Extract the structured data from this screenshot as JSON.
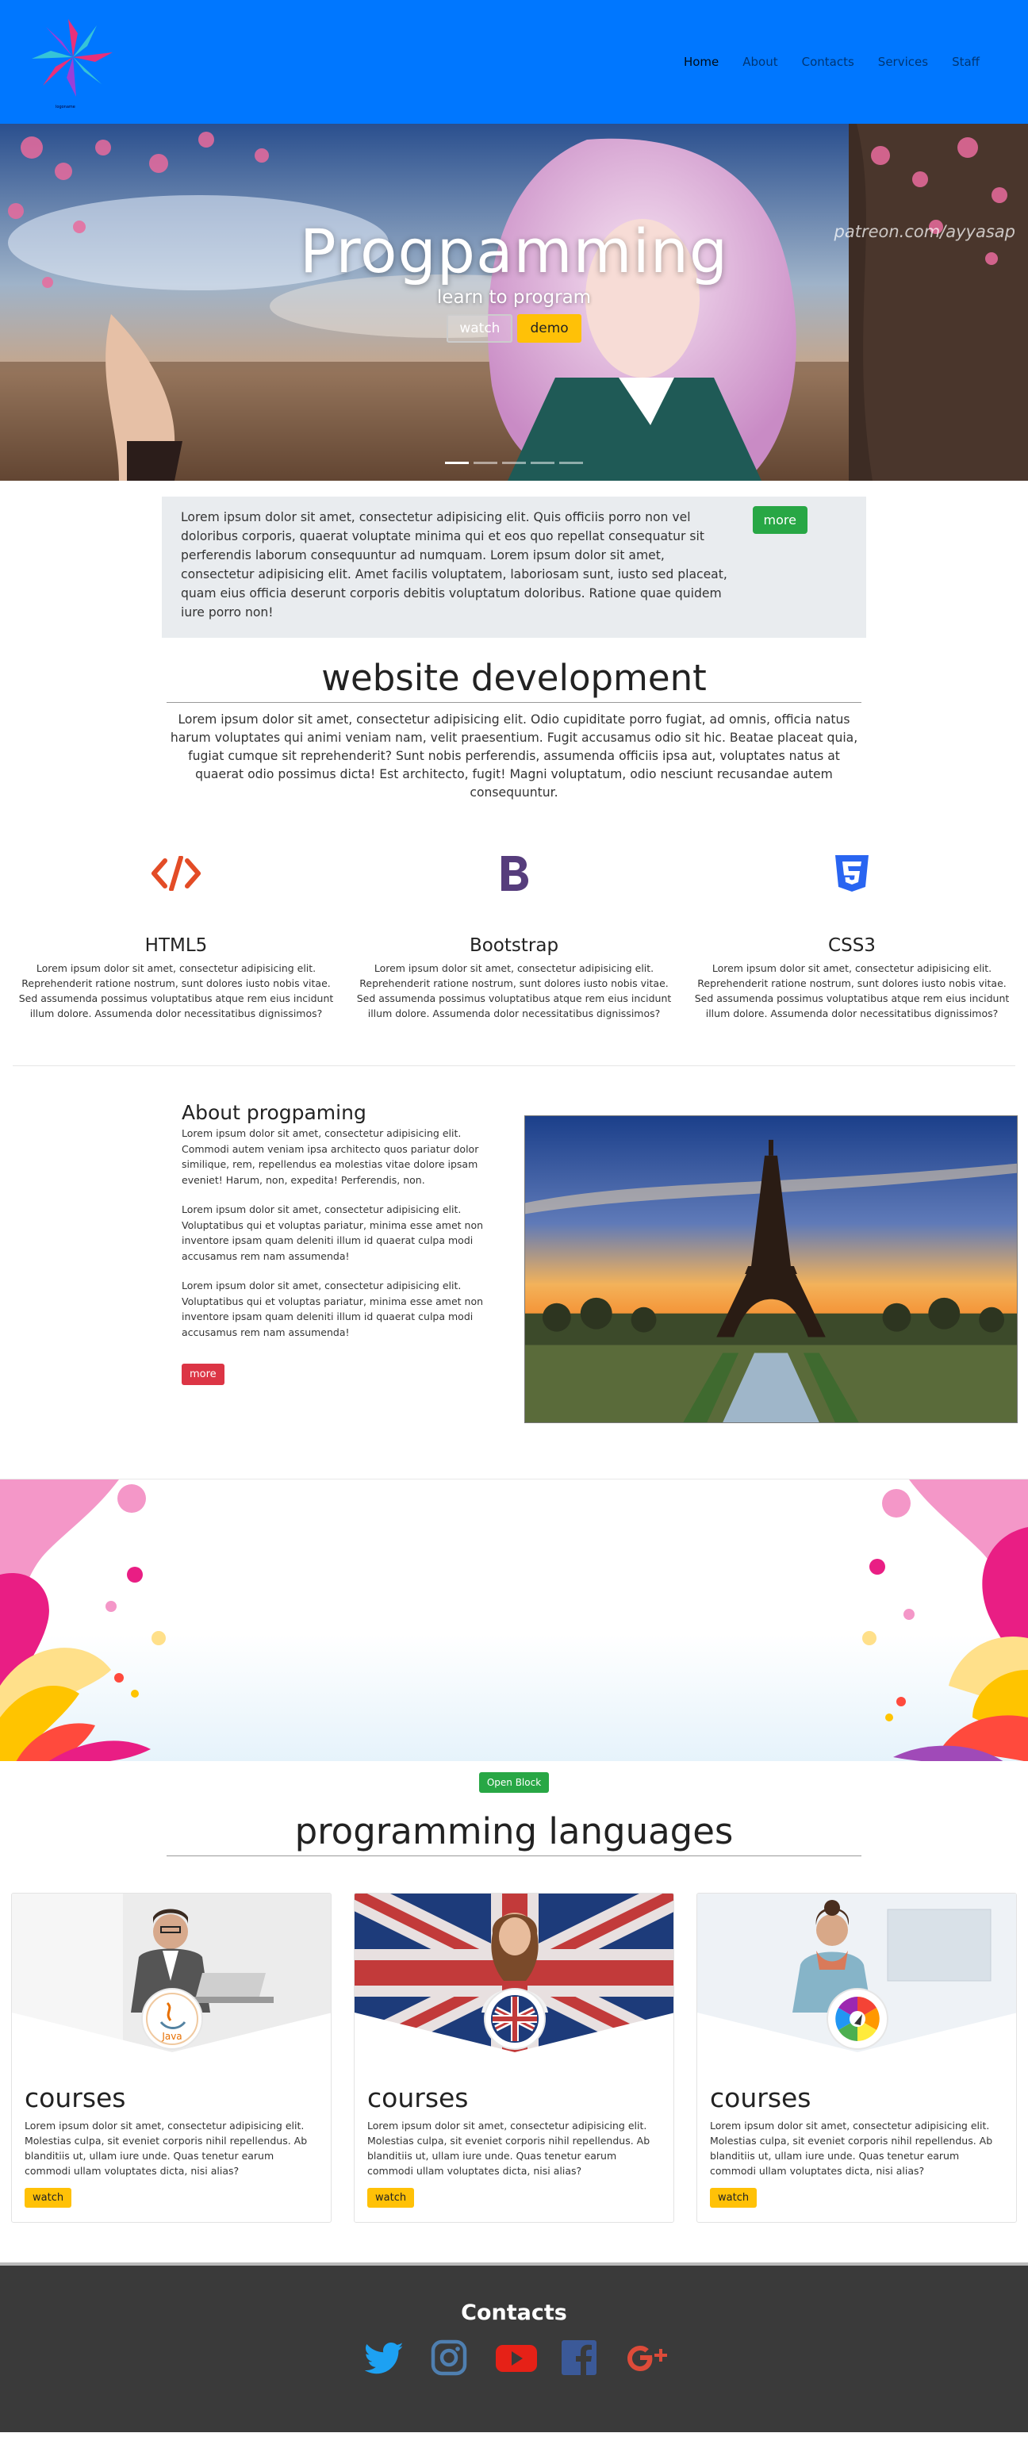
{
  "nav": {
    "logo_caption": "logoname",
    "items": [
      {
        "label": "Home",
        "active": true
      },
      {
        "label": "About",
        "active": false
      },
      {
        "label": "Contacts",
        "active": false
      },
      {
        "label": "Services",
        "active": false
      },
      {
        "label": "Staff",
        "active": false
      }
    ]
  },
  "hero": {
    "title": "Progpamming",
    "subtitle": "learn to program",
    "watch_label": "watch",
    "demo_label": "demo",
    "watermark": "patreon.com/ayyasap",
    "slides": 5,
    "active_slide": 0
  },
  "info": {
    "text": "Lorem ipsum dolor sit amet, consectetur adipisicing elit. Quis officiis porro non vel doloribus corporis, quaerat voluptate minima qui et eos quo repellat consequatur sit perferendis laborum consequuntur ad numquam. Lorem ipsum dolor sit amet, consectetur adipisicing elit. Amet facilis voluptatem, laboriosam sunt, iusto sed placeat, quam eius officia deserunt corporis debitis voluptatum doloribus. Ratione quae quidem iure porro non!",
    "more_label": "more"
  },
  "webdev": {
    "title": "website development",
    "text": "Lorem ipsum dolor sit amet, consectetur adipisicing elit. Odio cupiditate porro fugiat, ad omnis, officia natus harum voluptates qui animi veniam nam, velit praesentium. Fugit accusamus odio sit hic. Beatae placeat quia, fugiat cumque sit reprehenderit? Sunt nobis perferendis, assumenda officiis ipsa aut, voluptates natus at quaerat odio possimus dicta! Est architecto, fugit! Magni voluptatum, odio nesciunt recusandae autem consequuntur."
  },
  "features": [
    {
      "title": "HTML5",
      "icon": "code-icon",
      "color": "#e34c26",
      "text": "Lorem ipsum dolor sit amet, consectetur adipisicing elit. Reprehenderit ratione nostrum, sunt dolores iusto nobis vitae. Sed assumenda possimus voluptatibus atque rem eius incidunt illum dolore. Assumenda dolor necessitatibus dignissimos?"
    },
    {
      "title": "Bootstrap",
      "icon": "bootstrap-icon",
      "color": "#563d7c",
      "text": "Lorem ipsum dolor sit amet, consectetur adipisicing elit. Reprehenderit ratione nostrum, sunt dolores iusto nobis vitae. Sed assumenda possimus voluptatibus atque rem eius incidunt illum dolore. Assumenda dolor necessitatibus dignissimos?"
    },
    {
      "title": "CSS3",
      "icon": "css3-icon",
      "color": "#2965f1",
      "text": "Lorem ipsum dolor sit amet, consectetur adipisicing elit. Reprehenderit ratione nostrum, sunt dolores iusto nobis vitae. Sed assumenda possimus voluptatibus atque rem eius incidunt illum dolore. Assumenda dolor necessitatibus dignissimos?"
    }
  ],
  "about": {
    "title": "About progpaming",
    "paragraphs": [
      "Lorem ipsum dolor sit amet, consectetur adipisicing elit. Commodi autem veniam ipsa architecto quos pariatur dolor similique, rem, repellendus ea molestias vitae dolore ipsam eveniet! Harum, non, expedita! Perferendis, non.",
      "Lorem ipsum dolor sit amet, consectetur adipisicing elit. Voluptatibus qui et voluptas pariatur, minima esse amet non inventore ipsam quam deleniti illum id quaerat culpa modi accusamus rem nam assumenda!",
      "Lorem ipsum dolor sit amet, consectetur adipisicing elit. Voluptatibus qui et voluptas pariatur, minima esse amet non inventore ipsam quam deleniti illum id quaerat culpa modi accusamus rem nam assumenda!"
    ],
    "more_label": "more"
  },
  "banner": {
    "open_label": "Open Block"
  },
  "languages": {
    "title": "programming languages",
    "cards": [
      {
        "title": "courses",
        "badge": "java-icon",
        "text": "Lorem ipsum dolor sit amet, consectetur adipisicing elit. Molestias culpa, sit eveniet corporis nihil repellendus. Ab blanditiis ut, ullam iure unde. Quas tenetur earum commodi ullam voluptates dicta, nisi alias?",
        "watch_label": "watch"
      },
      {
        "title": "courses",
        "badge": "uk-flag-icon",
        "text": "Lorem ipsum dolor sit amet, consectetur adipisicing elit. Molestias culpa, sit eveniet corporis nihil repellendus. Ab blanditiis ut, ullam iure unde. Quas tenetur earum commodi ullam voluptates dicta, nisi alias?",
        "watch_label": "watch"
      },
      {
        "title": "courses",
        "badge": "color-wheel-icon",
        "text": "Lorem ipsum dolor sit amet, consectetur adipisicing elit. Molestias culpa, sit eveniet corporis nihil repellendus. Ab blanditiis ut, ullam iure unde. Quas tenetur earum commodi ullam voluptates dicta, nisi alias?",
        "watch_label": "watch"
      }
    ]
  },
  "footer": {
    "title": "Contacts",
    "socials": [
      {
        "name": "twitter-icon",
        "color": "#1da1f2"
      },
      {
        "name": "instagram-icon",
        "color": "#4f7fb0"
      },
      {
        "name": "youtube-icon",
        "color": "#e62117"
      },
      {
        "name": "facebook-icon",
        "color": "#3b5998"
      },
      {
        "name": "google-plus-icon",
        "color": "#dd4b39"
      }
    ]
  },
  "colors": {
    "navbar": "#0077ff",
    "accent_yellow": "#ffc107",
    "green": "#28a745",
    "red": "#dc3545",
    "footer": "#3a3a3a"
  }
}
